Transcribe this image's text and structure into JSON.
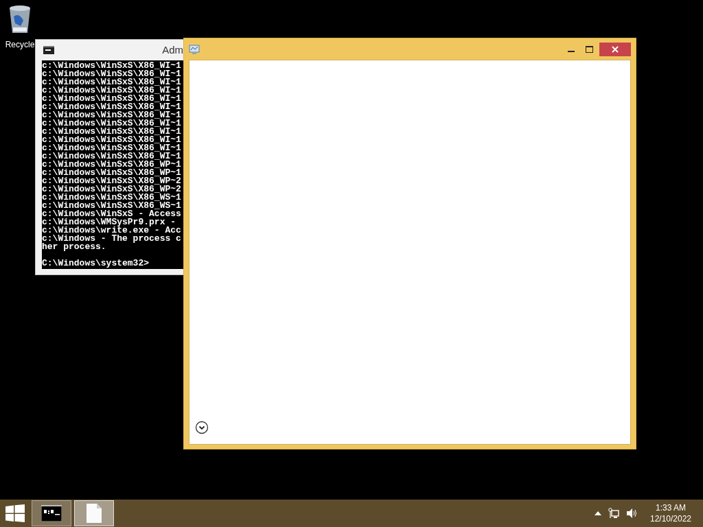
{
  "desktop_icons": [
    {
      "label": "Recycle"
    }
  ],
  "console_window": {
    "title": "Adm",
    "lines": [
      "c:\\Windows\\WinSxS\\X86_WI~1",
      "c:\\Windows\\WinSxS\\X86_WI~1",
      "c:\\Windows\\WinSxS\\X86_WI~1",
      "c:\\Windows\\WinSxS\\X86_WI~1",
      "c:\\Windows\\WinSxS\\X86_WI~1",
      "c:\\Windows\\WinSxS\\X86_WI~1",
      "c:\\Windows\\WinSxS\\X86_WI~1",
      "c:\\Windows\\WinSxS\\X86_WI~1",
      "c:\\Windows\\WinSxS\\X86_WI~1",
      "c:\\Windows\\WinSxS\\X86_WI~1",
      "c:\\Windows\\WinSxS\\X86_WI~1",
      "c:\\Windows\\WinSxS\\X86_WI~1",
      "c:\\Windows\\WinSxS\\X86_WP~1",
      "c:\\Windows\\WinSxS\\X86_WP~1",
      "c:\\Windows\\WinSxS\\X86_WP~2",
      "c:\\Windows\\WinSxS\\X86_WP~2",
      "c:\\Windows\\WinSxS\\X86_WS~1",
      "c:\\Windows\\WinSxS\\X86_WS~1",
      "c:\\Windows\\WinSxS - Access",
      "c:\\Windows\\WMSysPr9.prx -",
      "c:\\Windows\\write.exe - Acc",
      "c:\\Windows - The process c",
      "her process."
    ],
    "prompt": "C:\\Windows\\system32>"
  },
  "app_window": {
    "active": true
  },
  "taskbar": {
    "items": [
      {
        "kind": "console",
        "selected": false
      },
      {
        "kind": "document",
        "selected": true
      }
    ],
    "time": "1:33 AM",
    "date": "12/10/2022"
  }
}
